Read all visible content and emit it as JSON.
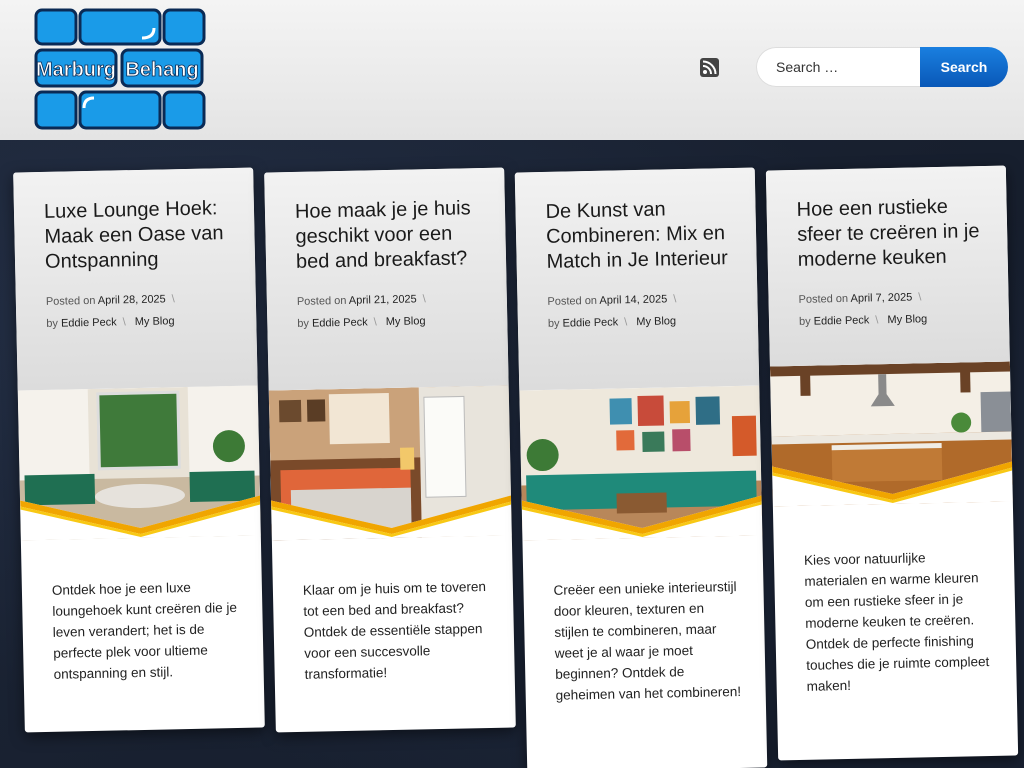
{
  "brand": {
    "logo_text_1": "Marburg",
    "logo_text_2": "Behang",
    "color_brick": "#1a9be8",
    "color_outline": "#0a2a55"
  },
  "header": {
    "rss_icon": "rss-icon",
    "search": {
      "placeholder": "Search …",
      "button_label": "Search"
    }
  },
  "colors": {
    "accent_blue": "#0958b8",
    "chevron_orange": "#f0a500",
    "chevron_yellow": "#f8c814"
  },
  "meta_labels": {
    "posted_on": "Posted on",
    "by": "by"
  },
  "posts": [
    {
      "title": "Luxe Lounge Hoek: Maak een Oase van Ontspanning",
      "date": "April 28, 2025",
      "author": "Eddie Peck",
      "category": "My Blog",
      "excerpt": "Ontdek hoe je een luxe loungehoek kunt creëren die je leven verandert; het is de perfecte plek voor ultieme ontspanning en stijl."
    },
    {
      "title": "Hoe maak je je huis geschikt voor een bed and breakfast?",
      "date": "April 21, 2025",
      "author": "Eddie Peck",
      "category": "My Blog",
      "excerpt": "Klaar om je huis om te toveren tot een bed and breakfast? Ontdek de essentiële stappen voor een succesvolle transformatie!"
    },
    {
      "title": "De Kunst van Combineren: Mix en Match in Je Interieur",
      "date": "April 14, 2025",
      "author": "Eddie Peck",
      "category": "My Blog",
      "excerpt": "Creëer een unieke interieurstijl door kleuren, texturen en stijlen te combineren, maar weet je al waar je moet beginnen? Ontdek de geheimen van het combineren!"
    },
    {
      "title": "Hoe een rustieke sfeer te creëren in je moderne keuken",
      "date": "April 7, 2025",
      "author": "Eddie Peck",
      "category": "My Blog",
      "excerpt": "Kies voor natuurlijke materialen en warme kleuren om een rustieke sfeer in je moderne keuken te creëren. Ontdek de perfecte finishing touches die je ruimte compleet maken!"
    }
  ]
}
